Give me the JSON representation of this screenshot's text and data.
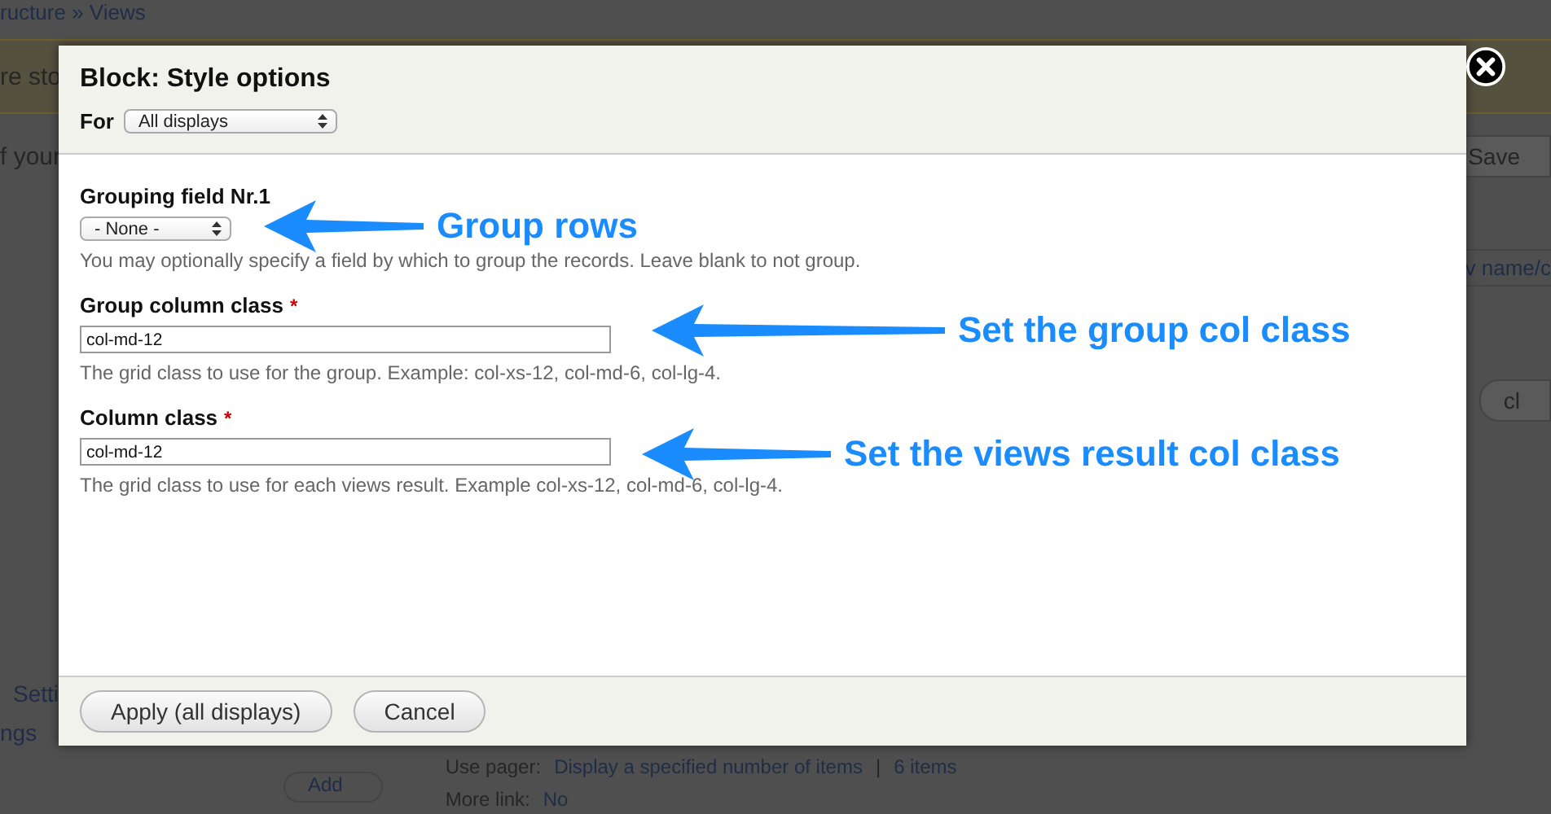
{
  "background": {
    "breadcrumb": "ructure » Views",
    "message": "re sto",
    "intro": "f your",
    "save_button": "Save",
    "name_link": "v name/c",
    "side_button": "cl",
    "settings_link": "Setti",
    "settings_link_2": "ngs",
    "add_button": "Add",
    "pager": {
      "label": "Use pager:",
      "value": "Display a specified number of items",
      "separator": "|",
      "count": "6 items"
    },
    "more_link": {
      "label": "More link:",
      "value": "No"
    }
  },
  "dialog": {
    "title": "Block: Style options",
    "for_label": "For",
    "for_select": "All displays",
    "fields": [
      {
        "kind": "select",
        "label": "Grouping field Nr.1",
        "value": "- None -",
        "description": "You may optionally specify a field by which to group the records. Leave blank to not group."
      },
      {
        "kind": "text",
        "label": "Group column class",
        "required_mark": "*",
        "value": "col-md-12",
        "description": "The grid class to use for the group. Example: col-xs-12, col-md-6, col-lg-4."
      },
      {
        "kind": "text",
        "label": "Column class",
        "required_mark": "*",
        "value": "col-md-12",
        "description": "The grid class to use for each views result. Example col-xs-12, col-md-6, col-lg-4."
      }
    ],
    "buttons": [
      "Apply (all displays)",
      "Cancel"
    ]
  },
  "annotations": [
    "Group rows",
    "Set the group col class",
    "Set the views result col class"
  ]
}
